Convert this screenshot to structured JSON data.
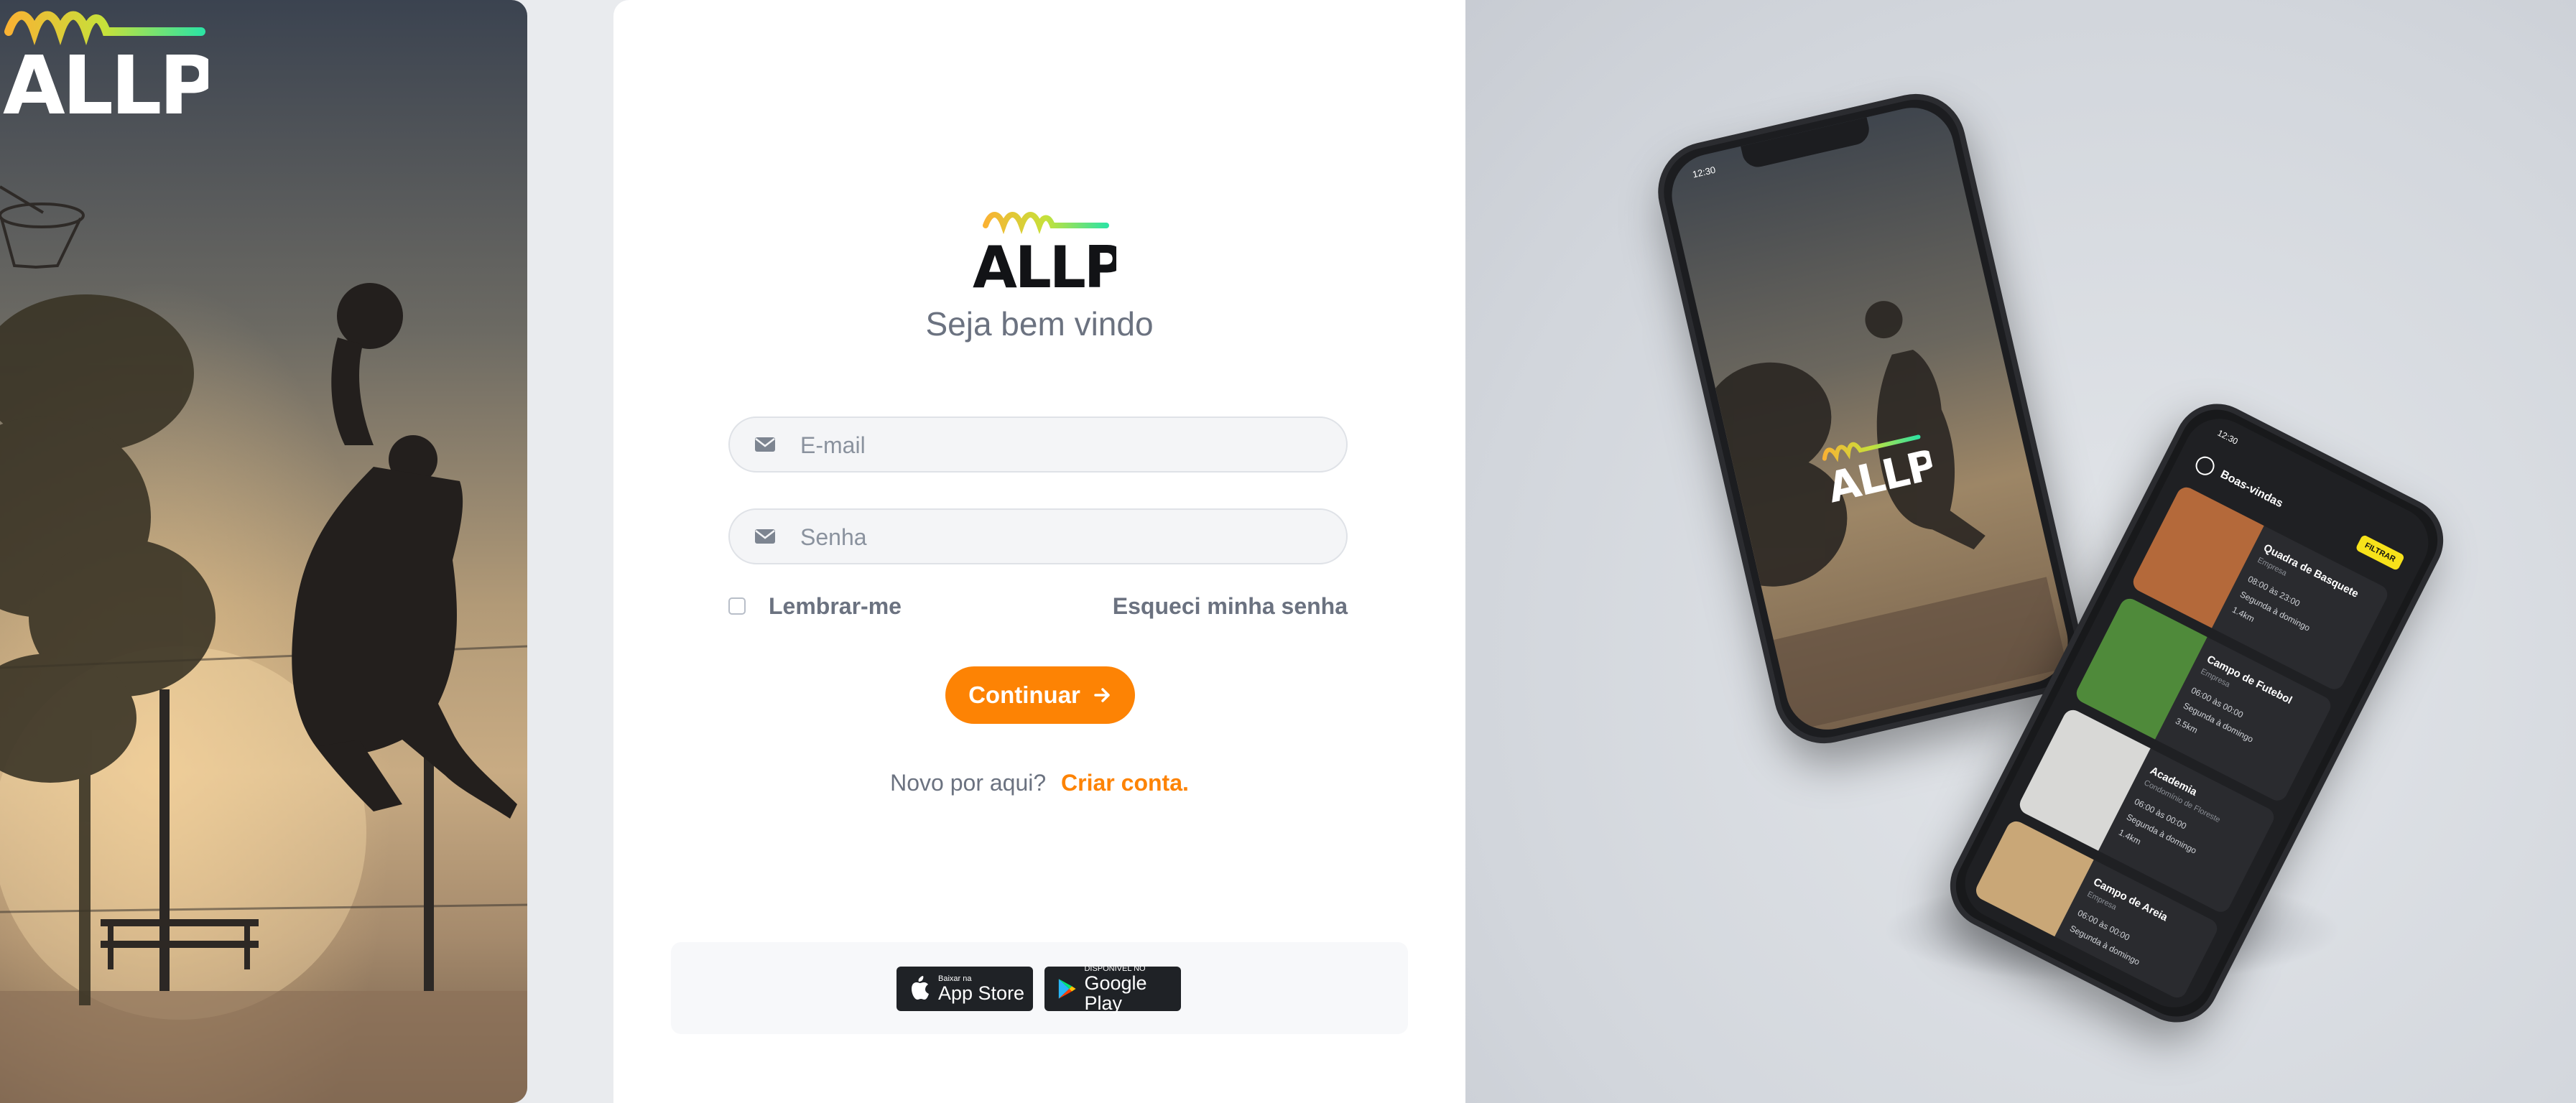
{
  "brand": {
    "name": "ALLP",
    "accent": "#fd8304",
    "wave_colors": [
      "#f9b233",
      "#c6e13a",
      "#2fe3a2"
    ]
  },
  "login": {
    "welcome": "Seja bem vindo",
    "email_placeholder": "E-mail",
    "email_value": "",
    "password_placeholder": "Senha",
    "password_value": "",
    "remember_label": "Lembrar-me",
    "forgot_label": "Esqueci minha senha",
    "continue_label": "Continuar",
    "signup_prompt": "Novo por aqui?",
    "signup_link": "Criar conta."
  },
  "stores": [
    {
      "small": "Baixar na",
      "big": "App Store",
      "icon": "apple-icon"
    },
    {
      "small": "DISPONÍVEL NO",
      "big": "Google Play",
      "icon": "google-play-icon"
    }
  ],
  "mockup": {
    "phone1_time": "12:30",
    "phone2_time": "12:30",
    "phone2_title": "Boas-vindas",
    "filter_label": "FILTRAR",
    "venues": [
      {
        "name": "Quadra de Basquete",
        "sub": "Empresa",
        "hours": "08:00 às 23:00",
        "days": "Segunda à domingo",
        "distance": "1.4km",
        "thumb": "#b4693a"
      },
      {
        "name": "Campo de Futebol",
        "sub": "Empresa",
        "hours": "06:00 às 00:00",
        "days": "Segunda à domingo",
        "distance": "3.5km",
        "thumb": "#4f8a3a"
      },
      {
        "name": "Academia",
        "sub": "Condomínio de Floreste",
        "hours": "06:00 às 00:00",
        "days": "Segunda à domingo",
        "distance": "1.4km",
        "thumb": "#d8d8d6"
      },
      {
        "name": "Campo de Areia",
        "sub": "Empresa",
        "hours": "06:00 às 00:00",
        "days": "Segunda à domingo",
        "distance": "",
        "thumb": "#c9a777"
      }
    ]
  }
}
